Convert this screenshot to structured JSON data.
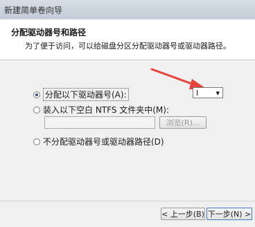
{
  "window": {
    "title": "新建简单卷向导"
  },
  "header": {
    "title": "分配驱动器号和路径",
    "subtitle": "为了便于访问，可以给磁盘分区分配驱动器号或驱动器路径。"
  },
  "options": {
    "assign_letter": {
      "label": "分配以下驱动器号(A):",
      "selected": true
    },
    "drive_letter_value": "I",
    "mount_ntfs": {
      "label": "装入以下空白 NTFS 文件夹中(M):",
      "selected": false
    },
    "browse_label": "浏览(R)...",
    "no_assign": {
      "label": "不分配驱动器号或驱动器路径(D)",
      "selected": false
    }
  },
  "footer": {
    "back_label": "< 上一步(B)",
    "next_label": "下一步(N) >"
  },
  "colors": {
    "arrow": "#e8433a",
    "accent": "#3b78c8"
  }
}
